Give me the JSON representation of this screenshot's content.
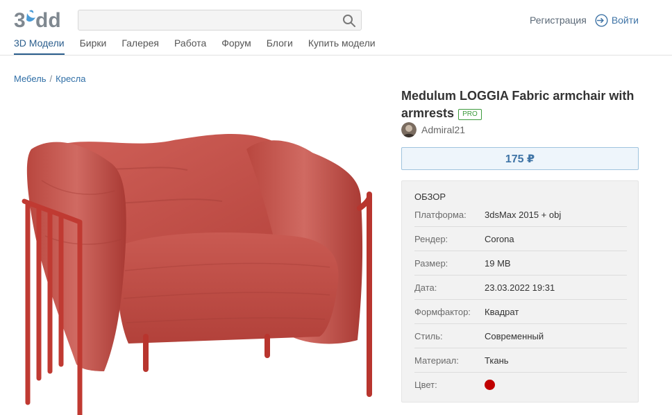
{
  "header": {
    "logo_alt": "3ddd",
    "search_placeholder": "",
    "register_label": "Регистрация",
    "login_label": "Войти"
  },
  "nav": {
    "items": [
      {
        "label": "3D Модели",
        "active": true
      },
      {
        "label": "Бирки",
        "active": false
      },
      {
        "label": "Галерея",
        "active": false
      },
      {
        "label": "Работа",
        "active": false
      },
      {
        "label": "Форум",
        "active": false
      },
      {
        "label": "Блоги",
        "active": false
      },
      {
        "label": "Купить модели",
        "active": false
      }
    ]
  },
  "breadcrumb": {
    "items": [
      "Мебель",
      "Кресла"
    ],
    "separator": "/"
  },
  "product": {
    "title": "Medulum LOGGIA Fabric armchair with armrests",
    "badge": "PRO",
    "author": "Admiral21",
    "price": "175 ₽"
  },
  "overview": {
    "heading": "ОБЗОР",
    "specs": [
      {
        "label": "Платформа:",
        "value": "3dsMax 2015 + obj"
      },
      {
        "label": "Рендер:",
        "value": "Corona"
      },
      {
        "label": "Размер:",
        "value": "19 MB"
      },
      {
        "label": "Дата:",
        "value": "23.03.2022 19:31"
      },
      {
        "label": "Формфактор:",
        "value": "Квадрат"
      },
      {
        "label": "Стиль:",
        "value": "Современный"
      },
      {
        "label": "Материал:",
        "value": "Ткань"
      },
      {
        "label": "Цвет:",
        "value": ""
      }
    ],
    "color_swatch": "#c00000"
  },
  "colors": {
    "accent": "#2a5d8c",
    "link": "#2f6ea6",
    "pro_green": "#3c9a3c",
    "chair_red": "#c4483f"
  },
  "icons": {
    "search": "search-icon",
    "login": "login-arrow-icon"
  }
}
